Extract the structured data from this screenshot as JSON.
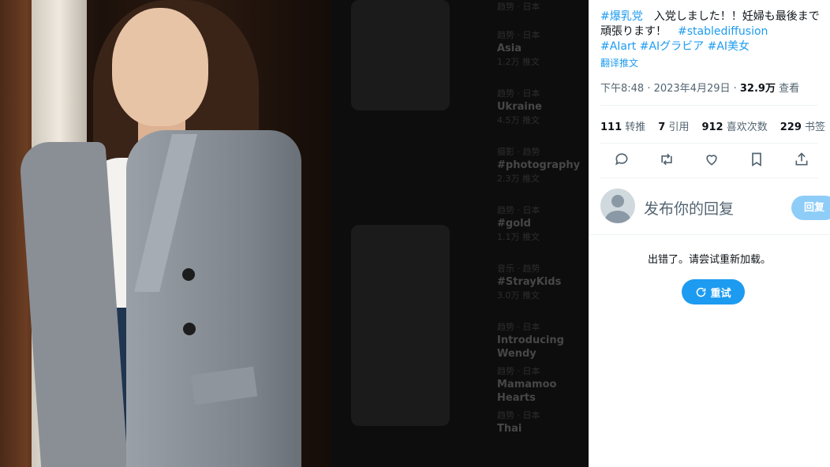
{
  "tweet": {
    "hashtag_1": "#爆乳党",
    "text_1": "　入党しました！！妊婦も最後まで頑張ります！　",
    "hashtag_2": "#stablediffusion",
    "hashtag_3": "#AIart",
    "hashtag_4": "#AIグラビア",
    "hashtag_5": "#AI美女",
    "translate_label": "翻译推文",
    "time": "下午8:48 · 2023年4月29日 · ",
    "views_count": "32.9万",
    "views_label": " 查看"
  },
  "stats": {
    "retweets_count": "111",
    "retweets_label": " 转推",
    "quotes_count": "7",
    "quotes_label": " 引用",
    "likes_count": "912",
    "likes_label": " 喜欢次数",
    "bookmarks_count": "229",
    "bookmarks_label": " 书签"
  },
  "actions": [
    "reply-icon",
    "retweet-icon",
    "like-icon",
    "bookmark-icon",
    "share-icon"
  ],
  "reply": {
    "placeholder": "发布你的回复",
    "button_label": "回复"
  },
  "error": {
    "message": "出错了。请尝试重新加载。",
    "retry_label": "重试"
  },
  "background_trends": [
    {
      "category": "趋势 · 日本",
      "name": "Asia",
      "count": "1.2万 推文"
    },
    {
      "category": "趋势 · 日本",
      "name": "Ukraine",
      "count": "4.5万 推文"
    },
    {
      "category": "摄影 · 趋势",
      "name": "#photography",
      "count": "2.3万 推文"
    },
    {
      "category": "趋势 · 日本",
      "name": "#gold",
      "count": "1.1万 推文"
    },
    {
      "category": "音乐 · 趋势",
      "name": "#StrayKids",
      "count": "3.0万 推文"
    },
    {
      "category": "趋势 · 日本",
      "name": "Introducing Wendy",
      "count": ""
    },
    {
      "category": "趋势 · 日本",
      "name": "Mamamoo Hearts",
      "count": ""
    },
    {
      "category": "趋势 · 日本",
      "name": "Thai",
      "count": ""
    }
  ],
  "colors": {
    "accent": "#1d9bf0",
    "reply_button_disabled": "#8ecdf8",
    "text_secondary": "#536471"
  }
}
